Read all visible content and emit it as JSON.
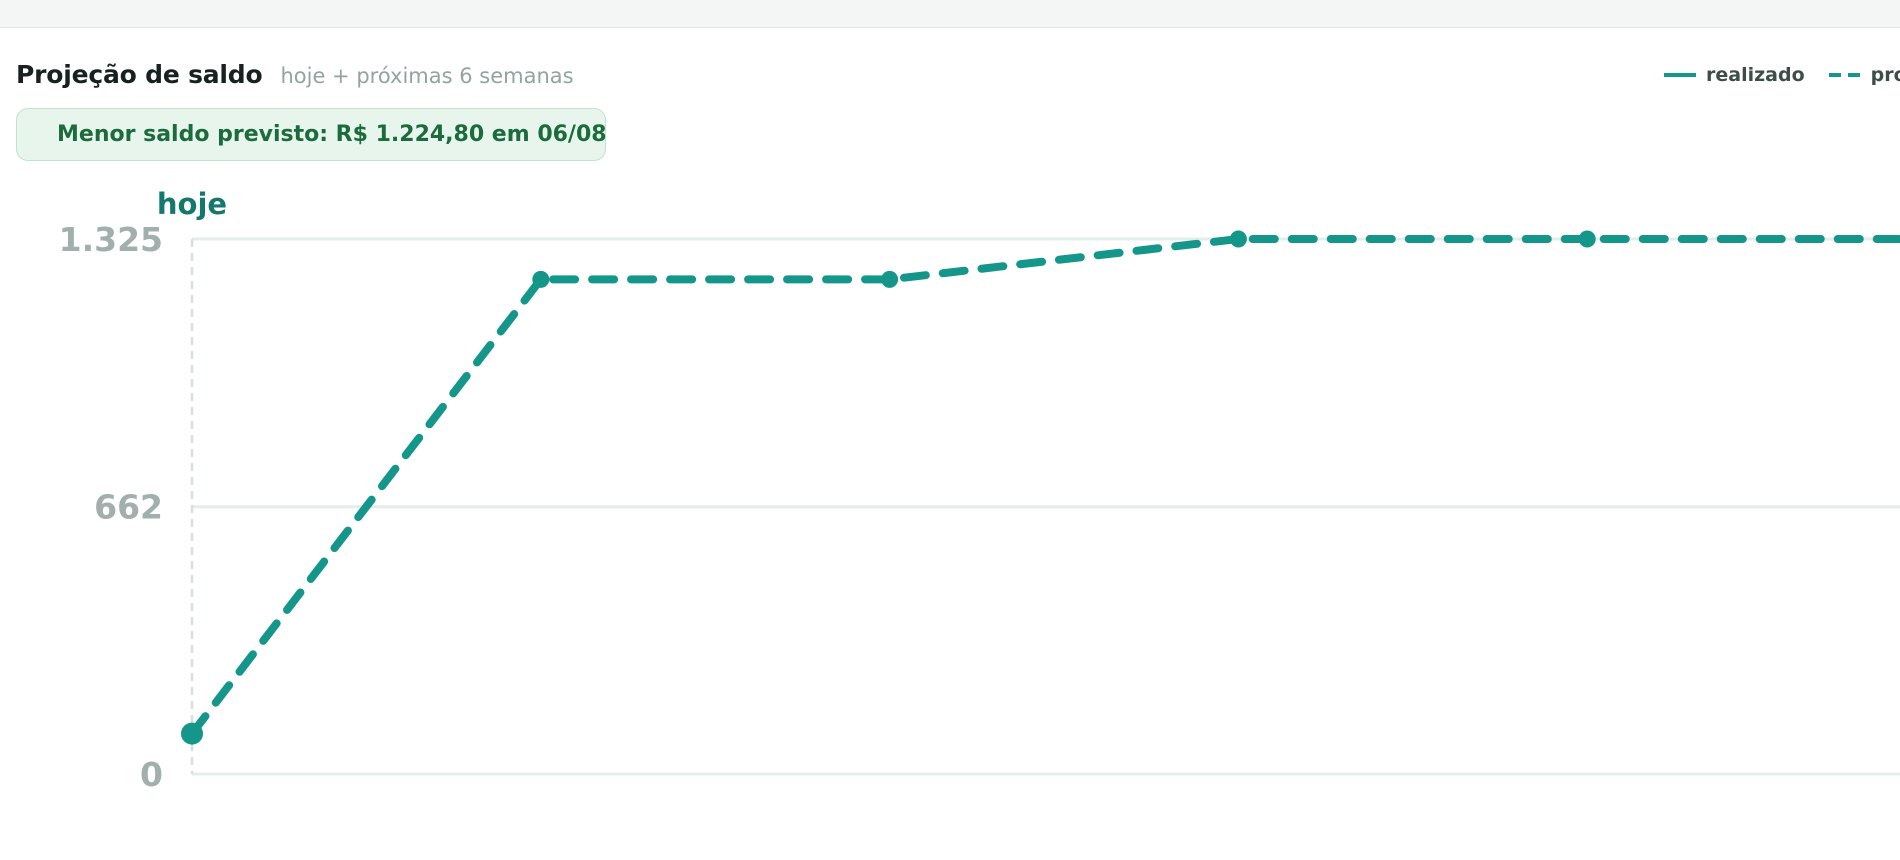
{
  "header": {
    "title": "Projeção de saldo",
    "subtitle": "hoje + próximas 6 semanas"
  },
  "legend": {
    "items": [
      {
        "label": "realizado",
        "style": "solid"
      },
      {
        "label": "pro",
        "style": "dashed"
      }
    ]
  },
  "callout": {
    "icon": "check-circle-icon",
    "text": "Menor saldo previsto: R$ 1.224,80 em 06/08"
  },
  "colors": {
    "accent": "#14968a",
    "callout_bg": "#e7f5ec",
    "callout_text": "#1c6b3d",
    "grid": "#e6eceb",
    "tick_text": "#a1b0ac",
    "today_label": "#15786f"
  },
  "chart_data": {
    "type": "line",
    "ylim": [
      0,
      1325
    ],
    "yticks": [
      {
        "value": 0,
        "label": "0"
      },
      {
        "value": 662,
        "label": "662"
      },
      {
        "value": 1325,
        "label": "1.325"
      }
    ],
    "today_label": "hoje",
    "grid": true,
    "legend_position": "top-right",
    "series": [
      {
        "name": "pro",
        "style": "dashed",
        "points": [
          {
            "x": 0,
            "y": 100
          },
          {
            "x": 1,
            "y": 1225
          },
          {
            "x": 2,
            "y": 1225
          },
          {
            "x": 3,
            "y": 1325
          },
          {
            "x": 4,
            "y": 1325
          },
          {
            "x": 5,
            "y": 1325
          }
        ]
      }
    ]
  }
}
